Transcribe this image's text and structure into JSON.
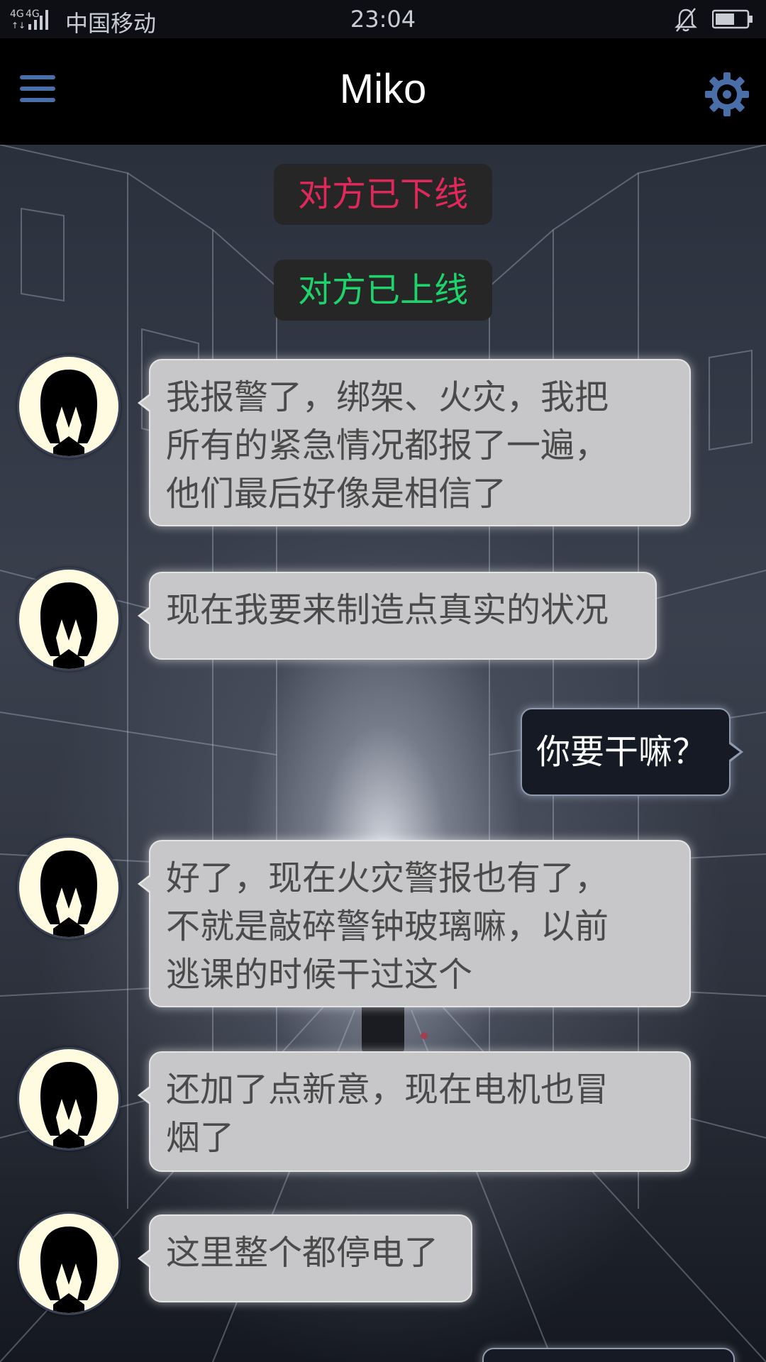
{
  "status_bar": {
    "network": "4G 4G",
    "carrier": "中国移动",
    "time": "23:04"
  },
  "header": {
    "title": "Miko",
    "menu_icon": "menu-icon",
    "settings_icon": "gear-icon"
  },
  "system_messages": [
    {
      "text": "对方已下线",
      "color": "#e0285a"
    },
    {
      "text": "对方已上线",
      "color": "#1fd26b"
    }
  ],
  "messages": [
    {
      "from": "Miko",
      "text": "我报警了，绑架、火灾，我把\n所有的紧急情况都报了一遍，\n他们最后好像是相信了"
    },
    {
      "from": "Miko",
      "text": "现在我要来制造点真实的状况"
    },
    {
      "from": "me",
      "text": "你要干嘛？"
    },
    {
      "from": "Miko",
      "text": "好了，现在火灾警报也有了，\n不就是敲碎警钟玻璃嘛，以前\n逃课的时候干过这个"
    },
    {
      "from": "Miko",
      "text": "还加了点新意，现在电机也冒\n烟了"
    },
    {
      "from": "Miko",
      "text": "这里整个都停电了"
    }
  ],
  "colors": {
    "header_bg": "#000000",
    "incoming_bubble": "#c7c7c9",
    "outgoing_bubble": "#151a24",
    "accent_icon": "#4a6fa8"
  }
}
